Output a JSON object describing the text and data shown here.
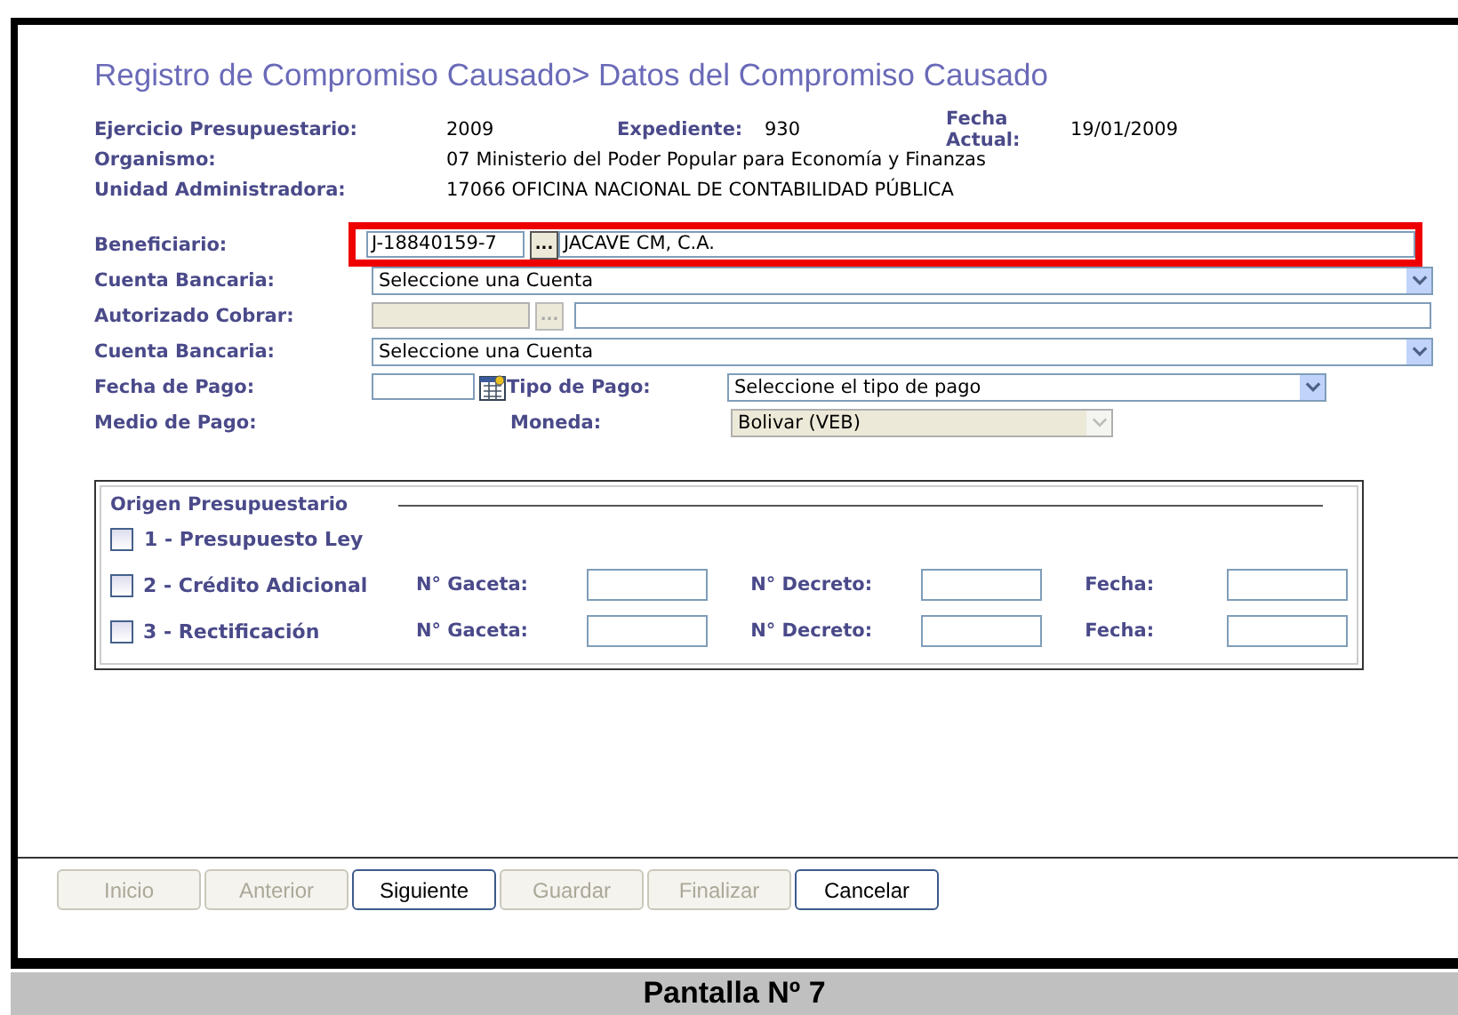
{
  "title": "Registro de Compromiso Causado> Datos del Compromiso Causado",
  "info": [
    {
      "label": "Ejercicio Presupuestario:",
      "value": "2009",
      "label2": "Expediente:",
      "value2": "930",
      "label3": "Fecha Actual:",
      "value3": "19/01/2009"
    },
    {
      "label": "Organismo:",
      "value": "07  Ministerio del Poder Popular para Economía y Finanzas"
    },
    {
      "label": "Unidad Administradora:",
      "value": "17066  OFICINA NACIONAL DE CONTABILIDAD PÚBLICA"
    }
  ],
  "form": {
    "beneficiario": {
      "label": "Beneficiario:",
      "code": "J-18840159-7",
      "button": "...",
      "name": "JACAVE CM, C.A.",
      "highlighted": true
    },
    "cuenta_bancaria": {
      "label": "Cuenta Bancaria:",
      "value": "Seleccione una Cuenta"
    },
    "autorizado_cobrar": {
      "label": "Autorizado Cobrar:",
      "button": "...",
      "disabled": true
    },
    "cuenta_bancaria_2": {
      "label": "Cuenta Bancaria:",
      "value": "Seleccione una Cuenta"
    },
    "fecha_pago": {
      "label": "Fecha de Pago:"
    },
    "tipo_pago": {
      "label": "Tipo de Pago:",
      "value": "Seleccione el tipo de pago"
    },
    "medio_pago": {
      "label": "Medio de Pago:"
    },
    "moneda": {
      "label": "Moneda:",
      "value": "Bolivar (VEB)",
      "disabled": true
    }
  },
  "origen": {
    "legend": "Origen Presupuestario",
    "options": [
      {
        "label": "1 - Presupuesto Ley",
        "checked": false
      },
      {
        "label": "2 - Crédito Adicional",
        "checked": false,
        "fields": [
          "N° Gaceta:",
          "N° Decreto:",
          "Fecha:"
        ]
      },
      {
        "label": "3 - Rectificación",
        "checked": false,
        "fields": [
          "N° Gaceta:",
          "N° Decreto:",
          "Fecha:"
        ]
      }
    ]
  },
  "buttons": [
    {
      "label": "Inicio",
      "disabled": true
    },
    {
      "label": "Anterior",
      "disabled": true
    },
    {
      "label": "Siguiente",
      "disabled": false
    },
    {
      "label": "Guardar",
      "disabled": true
    },
    {
      "label": "Finalizar",
      "disabled": true
    },
    {
      "label": "Cancelar",
      "disabled": false
    }
  ],
  "caption": "Pantalla Nº 7"
}
